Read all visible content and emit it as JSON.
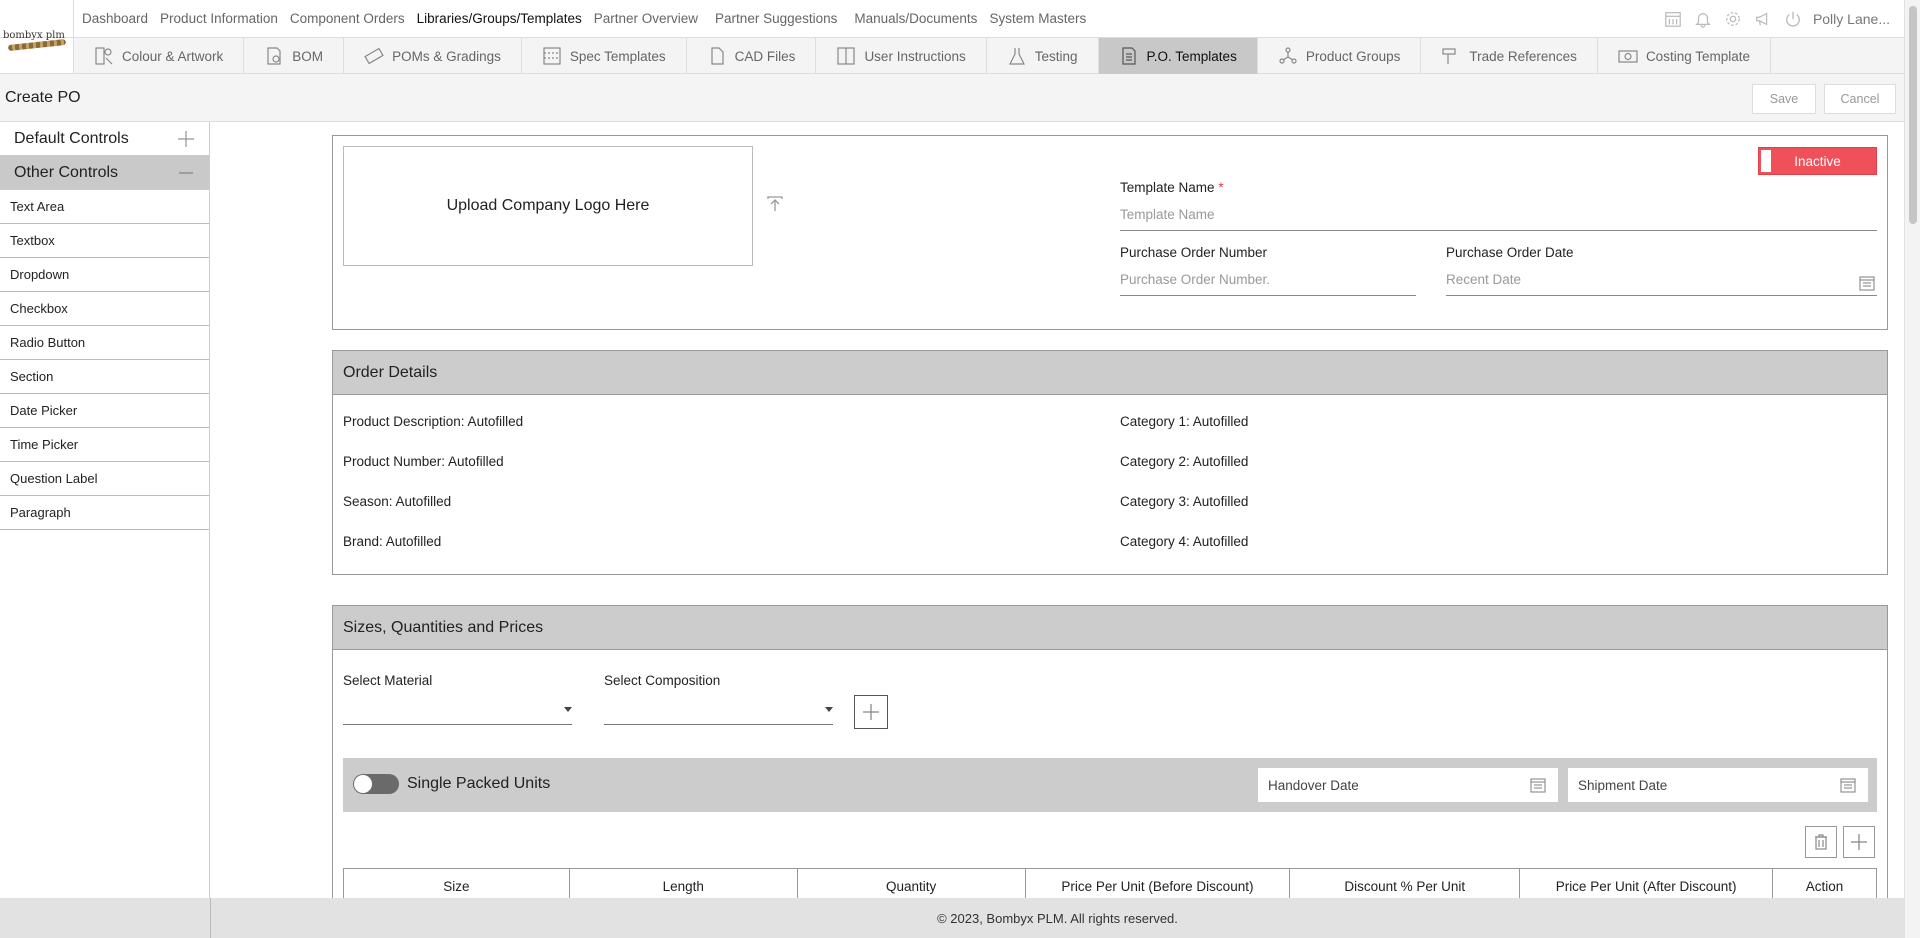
{
  "brand": {
    "logo_text": "bombyx plm"
  },
  "topnav": {
    "links": [
      {
        "label": "Dashboard",
        "active": false
      },
      {
        "label": "Product Information",
        "active": false
      },
      {
        "label": "Component Orders",
        "active": false
      },
      {
        "label": "Libraries/Groups/Templates",
        "active": true
      },
      {
        "label": "Partner Overview",
        "active": false
      },
      {
        "label": "Partner Suggestions",
        "active": false
      },
      {
        "label": "Manuals/Documents",
        "active": false
      },
      {
        "label": "System Masters",
        "active": false
      }
    ],
    "user": "Polly Lane...",
    "icons": [
      "calendar-icon",
      "bell-icon",
      "gear-icon",
      "megaphone-icon",
      "power-icon"
    ]
  },
  "subnav": {
    "tabs": [
      {
        "label": "Colour & Artwork",
        "icon": "palette-icon",
        "active": false
      },
      {
        "label": "BOM",
        "icon": "document-icon",
        "active": false
      },
      {
        "label": "POMs & Gradings",
        "icon": "ruler-icon",
        "active": false
      },
      {
        "label": "Spec Templates",
        "icon": "grid-icon",
        "active": false
      },
      {
        "label": "CAD Files",
        "icon": "file-icon",
        "active": false
      },
      {
        "label": "User Instructions",
        "icon": "instructions-icon",
        "active": false
      },
      {
        "label": "Testing",
        "icon": "flask-icon",
        "active": false
      },
      {
        "label": "P.O. Templates",
        "icon": "po-document-icon",
        "active": true
      },
      {
        "label": "Product Groups",
        "icon": "network-icon",
        "active": false
      },
      {
        "label": "Trade References",
        "icon": "hammer-icon",
        "active": false
      },
      {
        "label": "Costing Template",
        "icon": "money-icon",
        "active": false
      }
    ]
  },
  "page": {
    "title": "Create PO",
    "save": "Save",
    "cancel": "Cancel"
  },
  "sidebar": {
    "default_controls": "Default Controls",
    "other_controls": "Other Controls",
    "items": [
      "Text Area",
      "Textbox",
      "Dropdown",
      "Checkbox",
      "Radio Button",
      "Section",
      "Date Picker",
      "Time Picker",
      "Question Label",
      "Paragraph"
    ]
  },
  "header_card": {
    "upload_logo": "Upload Company Logo Here",
    "status": "Inactive",
    "template_name_label": "Template Name",
    "required_mark": "*",
    "template_name_placeholder": "Template Name",
    "po_number_label": "Purchase Order Number",
    "po_number_placeholder": "Purchase Order Number.",
    "po_date_label": "Purchase Order Date",
    "po_date_placeholder": "Recent Date"
  },
  "order_details": {
    "title": "Order Details",
    "left": [
      "Product Description: Autofilled",
      "Product Number: Autofilled",
      "Season: Autofilled",
      "Brand: Autofilled"
    ],
    "right": [
      "Category 1: Autofilled",
      "Category 2: Autofilled",
      "Category 3: Autofilled",
      "Category 4: Autofilled"
    ]
  },
  "sizes": {
    "title": "Sizes, Quantities and Prices",
    "select_material": "Select Material",
    "select_composition": "Select Composition",
    "single_packed_units": "Single Packed Units",
    "single_packed_on": false,
    "handover_date": "Handover Date",
    "shipment_date": "Shipment Date",
    "columns": [
      "Size",
      "Length",
      "Quantity",
      "Price Per Unit (Before Discount)",
      "Discount % Per Unit",
      "Price Per Unit (After Discount)",
      "Action"
    ]
  },
  "footer": {
    "copyright": "© 2023, Bombyx PLM. All rights reserved."
  },
  "colors": {
    "accent_inactive": "#f0505a",
    "section_bg": "#cccccc",
    "active_tab": "#c8c8c8"
  }
}
